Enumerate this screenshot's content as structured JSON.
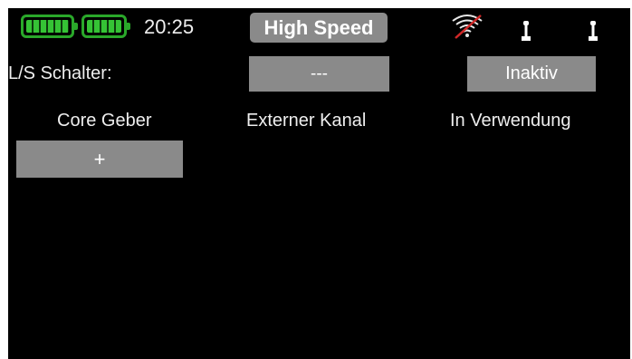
{
  "status_bar": {
    "time": "20:25",
    "mode": "High Speed",
    "colors": {
      "battery": "#35c335",
      "wifi_off": "#d02828"
    },
    "icons": [
      "transmitter-battery-icon",
      "receiver-battery-icon",
      "wifi-off-icon",
      "stick-left-icon",
      "stick-right-icon"
    ]
  },
  "switch_row": {
    "label": "L/S Schalter:",
    "switch_value": "---",
    "status_value": "Inaktiv"
  },
  "columns": {
    "core": "Core Geber",
    "external": "Externer Kanal",
    "in_use": "In Verwendung"
  },
  "add_button": "+"
}
